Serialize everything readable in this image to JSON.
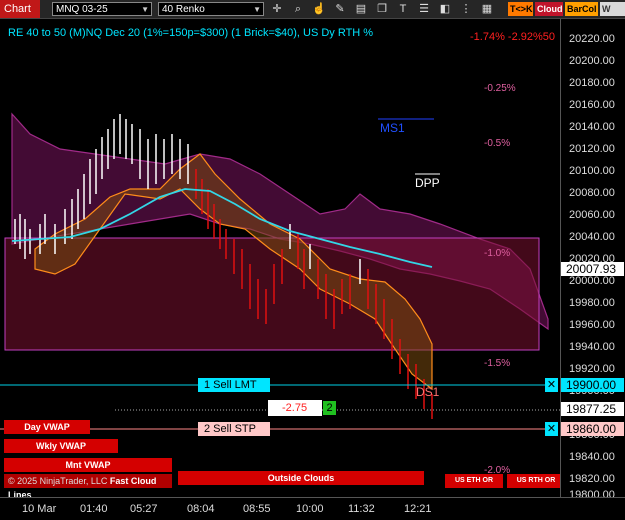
{
  "toolbar": {
    "chart_tab": "Chart",
    "instrument": "MNQ 03-25",
    "bar_type": "40 Renko",
    "icons": [
      "crosshair-icon",
      "zoom-icon",
      "hand-pointer-icon",
      "pencil-icon",
      "chart-style-icon",
      "copy-icon",
      "text-icon",
      "list-icon",
      "object-icon",
      "dots-icon"
    ],
    "tags": [
      {
        "label": "T<>K",
        "color": "#ff7a00"
      },
      {
        "label": "Cloud",
        "color": "#c0142a"
      },
      {
        "label": "BarCol",
        "color": "#ffa000"
      },
      {
        "label": "W VW",
        "color": "#d9d9d9"
      }
    ]
  },
  "header": {
    "title": "RE 40 to 50 (M)NQ Dec 20 (1%=150p=$300) (1 Brick=$40), US Dy RTH %",
    "top_right": "-1.74% -2.92%50"
  },
  "y_axis": {
    "ticks": [
      "20220.00",
      "20200.00",
      "20180.00",
      "20160.00",
      "20140.00",
      "20120.00",
      "20100.00",
      "20080.00",
      "20060.00",
      "20040.00",
      "20020.00",
      "20000.00",
      "19980.00",
      "19960.00",
      "19940.00",
      "19920.00",
      "19900.00",
      "19880.00",
      "19860.00",
      "19840.00",
      "19820.00",
      "19800.00"
    ],
    "last_price": "20007.93",
    "limit_price": "19900.00",
    "current_price": "19877.25",
    "stop_price": "19860.00"
  },
  "x_axis": {
    "ticks": [
      "10 Mar",
      "01:40",
      "05:27",
      "08:04",
      "08:55",
      "10:00",
      "11:32",
      "12:21"
    ]
  },
  "percent_levels": [
    "-0.25%",
    "-0.5%",
    "-1.0%",
    "-1.5%",
    "-2.0%"
  ],
  "markers": {
    "ms1": "MS1",
    "dpp": "DPP",
    "ds1": "DS1"
  },
  "orders": {
    "sell_limit": "1 Sell LMT",
    "sell_stop": "2 Sell STP",
    "close_glyph": "✕",
    "pnl": "-2.75",
    "qty": "2"
  },
  "buttons": {
    "day_vwap": "Day VWAP",
    "wkly_vwap": "Wkly VWAP",
    "mnt_vwap": "Mnt VWAP",
    "outside_clouds": "Outside Clouds",
    "us_eth_or": "US ETH OR",
    "us_rth_or": "US RTH OR"
  },
  "watermark": "© 2025 NinjaTrader, LLC",
  "footer_text": "Fast Cloud Lines",
  "colors": {
    "up_brick": "#ffffff",
    "down_brick": "#e01010",
    "cloud": "#8a1a6a",
    "band": "#ff8c1a",
    "ema": "#33d6e6",
    "accent": "#00e5ff"
  }
}
